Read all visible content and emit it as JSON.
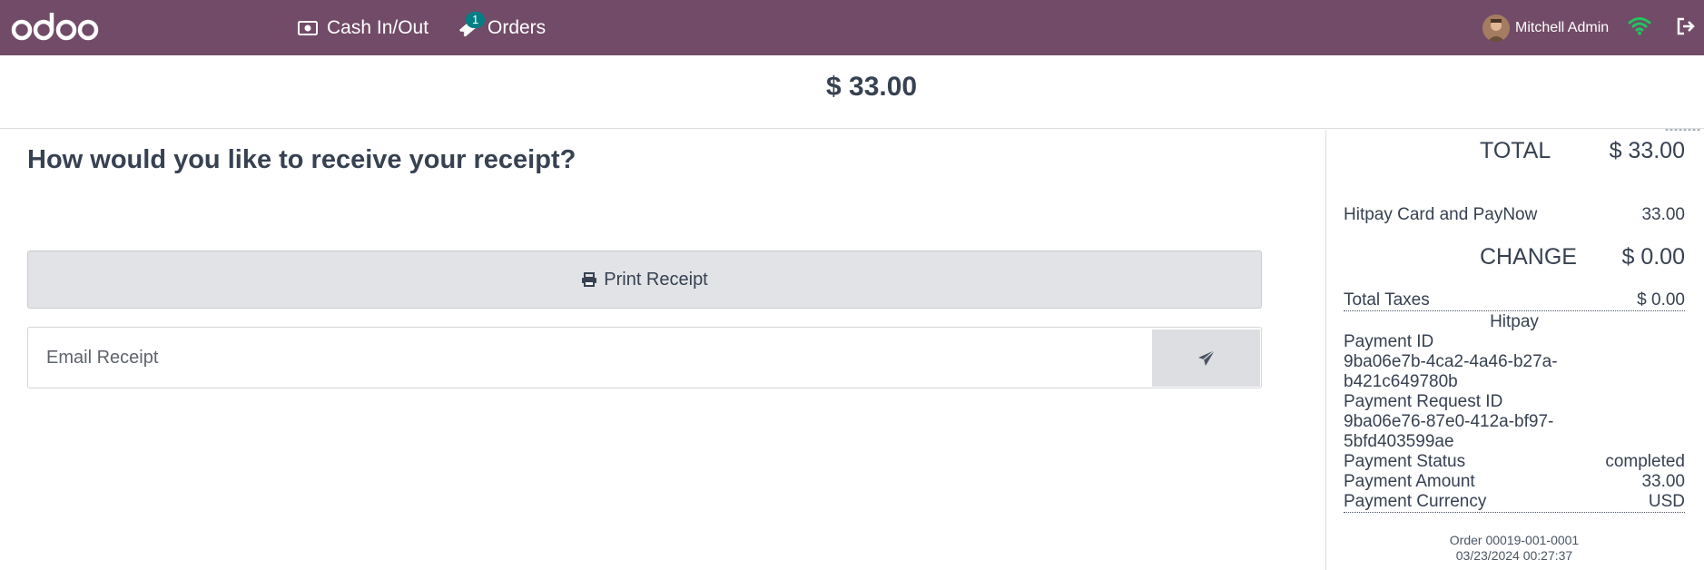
{
  "navbar": {
    "logo_text": "odoo",
    "cash_label": "Cash In/Out",
    "orders_label": "Orders",
    "orders_badge": "1",
    "user_name": "Mitchell Admin",
    "bg_color": "#714B67",
    "badge_color": "#017e84",
    "wifi_color": "#22c55e"
  },
  "header": {
    "amount": "$ 33.00"
  },
  "receipt_options": {
    "question": "How would you like to receive your receipt?",
    "print_label": "Print Receipt",
    "email_placeholder": "Email Receipt"
  },
  "receipt": {
    "separator": "--------",
    "total_label": "TOTAL",
    "total_value": "$ 33.00",
    "payment_method": "Hitpay Card and PayNow",
    "payment_method_value": "33.00",
    "change_label": "CHANGE",
    "change_value": "$ 0.00",
    "taxes_label": "Total Taxes",
    "taxes_value": "$ 0.00",
    "provider": "Hitpay",
    "payment_id_label": "Payment ID",
    "payment_id_line1": "9ba06e7b-4ca2-4a46-b27a-",
    "payment_id_line2": "b421c649780b",
    "payment_request_label": "Payment Request ID",
    "payment_request_line1": "9ba06e76-87e0-412a-bf97-",
    "payment_request_line2": "5bfd403599ae",
    "status_label": "Payment Status",
    "status_value": "completed",
    "amount_label": "Payment Amount",
    "amount_value": "33.00",
    "currency_label": "Payment Currency",
    "currency_value": "USD",
    "order_ref": "Order 00019-001-0001",
    "order_date": "03/23/2024 00:27:37"
  }
}
